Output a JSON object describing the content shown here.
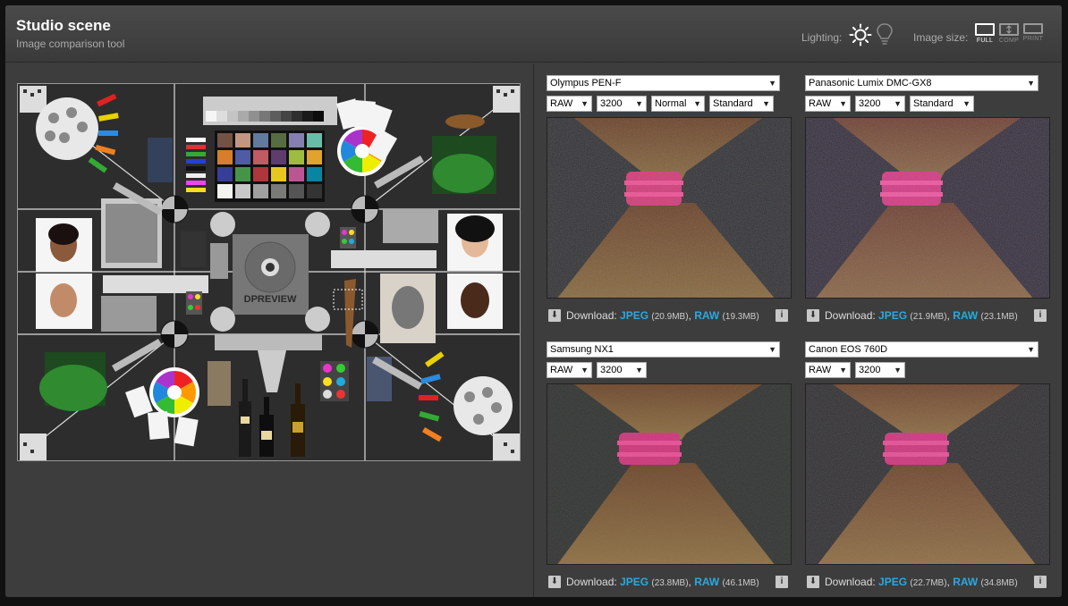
{
  "header": {
    "title": "Studio scene",
    "subtitle": "Image comparison tool",
    "lighting_label": "Lighting:",
    "image_size_label": "Image size:",
    "sizes": [
      "FULL",
      "COMP",
      "PRINT"
    ],
    "active_size": "FULL"
  },
  "cells": [
    {
      "camera": "Olympus PEN-F",
      "options": [
        "RAW",
        "3200",
        "Normal",
        "Standard"
      ],
      "download_label": "Download:",
      "jpeg_label": "JPEG",
      "jpeg_size": "(20.9MB)",
      "raw_label": "RAW",
      "raw_size": "(19.3MB)"
    },
    {
      "camera": "Panasonic Lumix DMC-GX8",
      "options": [
        "RAW",
        "3200",
        "Standard"
      ],
      "download_label": "Download:",
      "jpeg_label": "JPEG",
      "jpeg_size": "(21.9MB)",
      "raw_label": "RAW",
      "raw_size": "(23.1MB)"
    },
    {
      "camera": "Samsung NX1",
      "options": [
        "RAW",
        "3200"
      ],
      "download_label": "Download:",
      "jpeg_label": "JPEG",
      "jpeg_size": "(23.8MB)",
      "raw_label": "RAW",
      "raw_size": "(46.1MB)"
    },
    {
      "camera": "Canon EOS 760D",
      "options": [
        "RAW",
        "3200"
      ],
      "download_label": "Download:",
      "jpeg_label": "JPEG",
      "jpeg_size": "(22.7MB)",
      "raw_label": "RAW",
      "raw_size": "(34.8MB)"
    }
  ],
  "scene_text": {
    "logo": "DPREVIEW"
  },
  "colors": {
    "accent_link": "#2aa9e0",
    "panel_bg": "#3d3d3d",
    "header_bg": "#444444"
  },
  "icons": [
    "sun-icon",
    "bulb-icon",
    "download-icon",
    "info-icon"
  ]
}
